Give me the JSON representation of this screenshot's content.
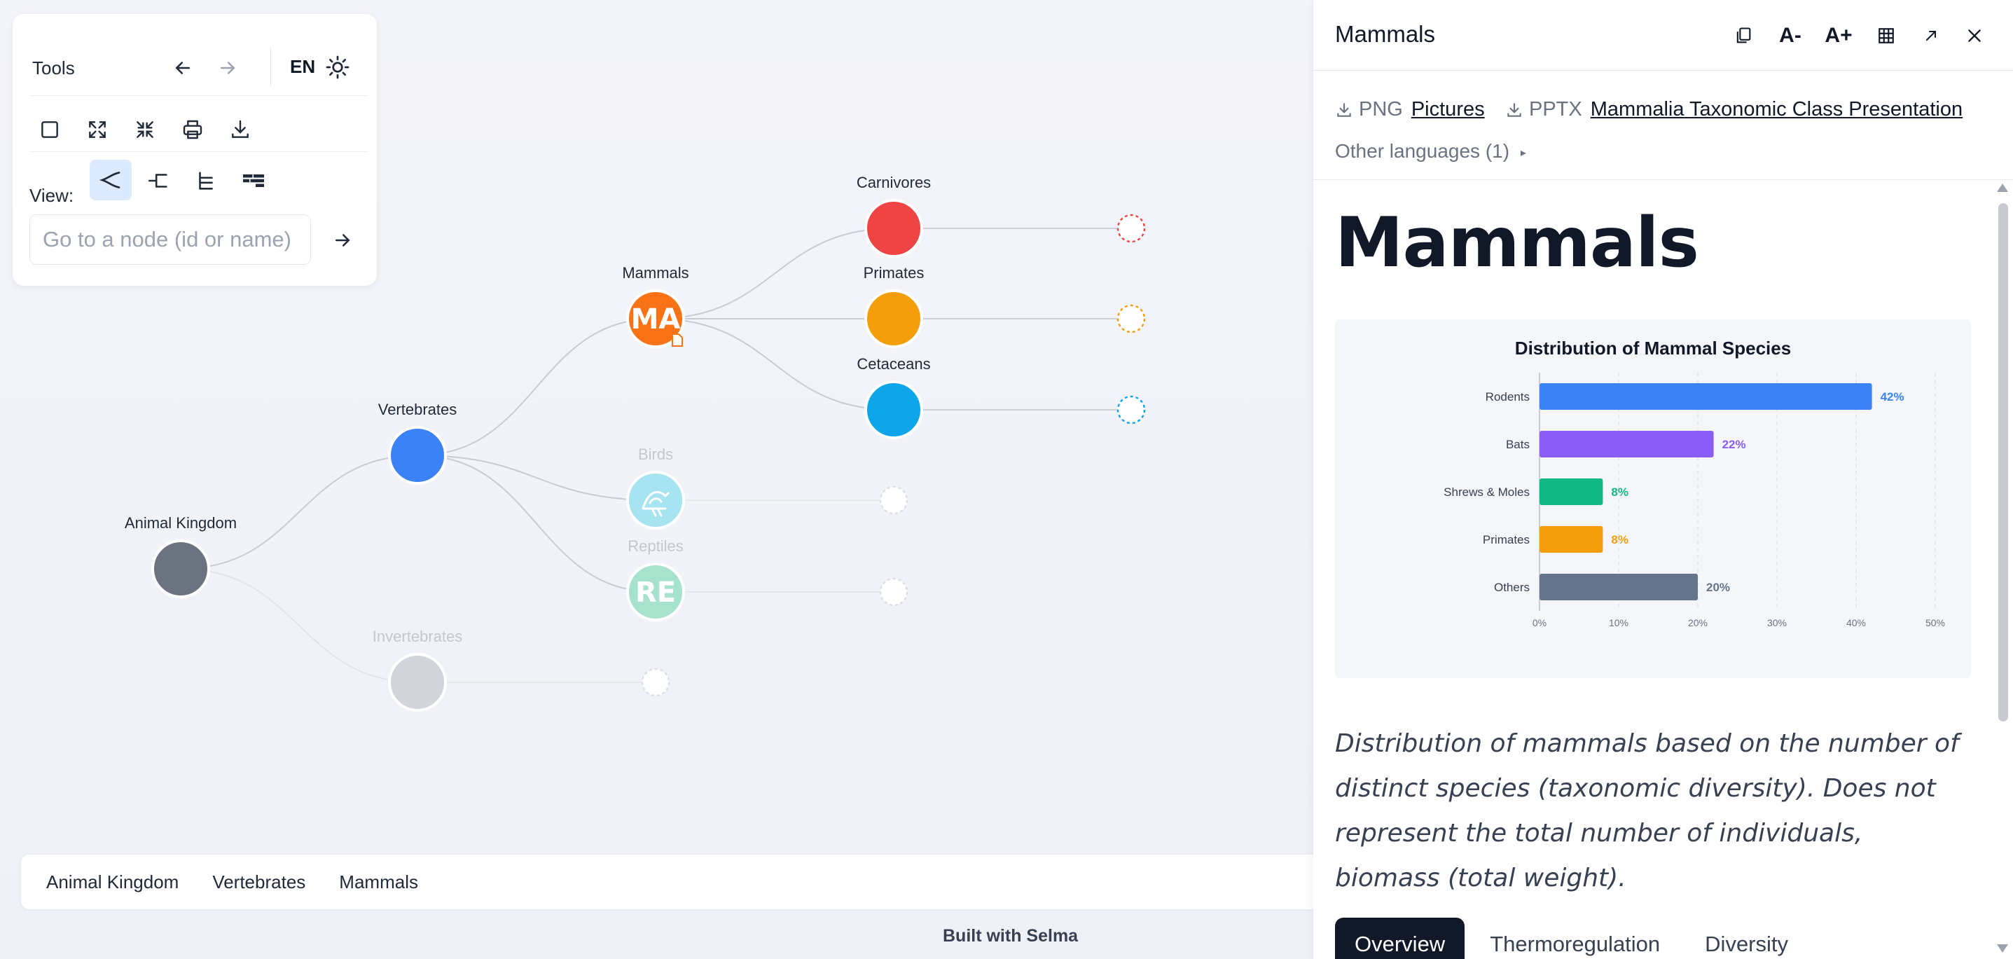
{
  "tools": {
    "title": "Tools",
    "lang": "EN",
    "view_label": "View:",
    "search_placeholder": "Go to a node (id or name)"
  },
  "tree": {
    "nodes": [
      {
        "id": "animal",
        "label": "Animal Kingdom",
        "color": "#6b7280",
        "faded": false,
        "text": ""
      },
      {
        "id": "vert",
        "label": "Vertebrates",
        "color": "#3b82f6",
        "faded": false,
        "text": ""
      },
      {
        "id": "invert",
        "label": "Invertebrates",
        "color": "#d1d5db",
        "faded": true,
        "text": ""
      },
      {
        "id": "mammals",
        "label": "Mammals",
        "color": "#f97316",
        "faded": false,
        "text": "MA"
      },
      {
        "id": "birds",
        "label": "Birds",
        "color": "#a5e4f0",
        "faded": true,
        "text": ""
      },
      {
        "id": "reptiles",
        "label": "Reptiles",
        "color": "#a7e3cc",
        "faded": true,
        "text": "RE"
      },
      {
        "id": "carnivores",
        "label": "Carnivores",
        "color": "#ef4444",
        "faded": false,
        "text": ""
      },
      {
        "id": "primates",
        "label": "Primates",
        "color": "#f59e0b",
        "faded": false,
        "text": ""
      },
      {
        "id": "cetaceans",
        "label": "Cetaceans",
        "color": "#0ea5e9",
        "faded": false,
        "text": ""
      }
    ]
  },
  "breadcrumb": [
    "Animal Kingdom",
    "Vertebrates",
    "Mammals"
  ],
  "footer": {
    "built_with": "Built with Selma"
  },
  "panel": {
    "title": "Mammals",
    "font_smaller": "A-",
    "font_larger": "A+",
    "downloads": [
      {
        "format": "PNG",
        "name": "Pictures"
      },
      {
        "format": "PPTX",
        "name": "Mammalia Taxonomic Class Presentation"
      }
    ],
    "other_languages": "Other languages (1)",
    "heading": "Mammals",
    "caption": "Distribution of mammals based on the number of distinct species (taxonomic diversity). Does not represent the total number of individuals, biomass (total weight).",
    "tabs": [
      "Overview",
      "Thermoregulation",
      "Diversity"
    ]
  },
  "chart_data": {
    "type": "bar",
    "orientation": "horizontal",
    "title": "Distribution of Mammal Species",
    "categories": [
      "Rodents",
      "Bats",
      "Shrews & Moles",
      "Primates",
      "Others"
    ],
    "values": [
      42,
      22,
      8,
      8,
      20
    ],
    "value_labels": [
      "42%",
      "22%",
      "8%",
      "8%",
      "20%"
    ],
    "colors": [
      "#3b82f6",
      "#8b5cf6",
      "#10b981",
      "#f59e0b",
      "#64748b"
    ],
    "xlim": [
      0,
      50
    ],
    "xticks": [
      "0%",
      "10%",
      "20%",
      "30%",
      "40%",
      "50%"
    ],
    "xlabel": "",
    "ylabel": "",
    "grid": true
  }
}
